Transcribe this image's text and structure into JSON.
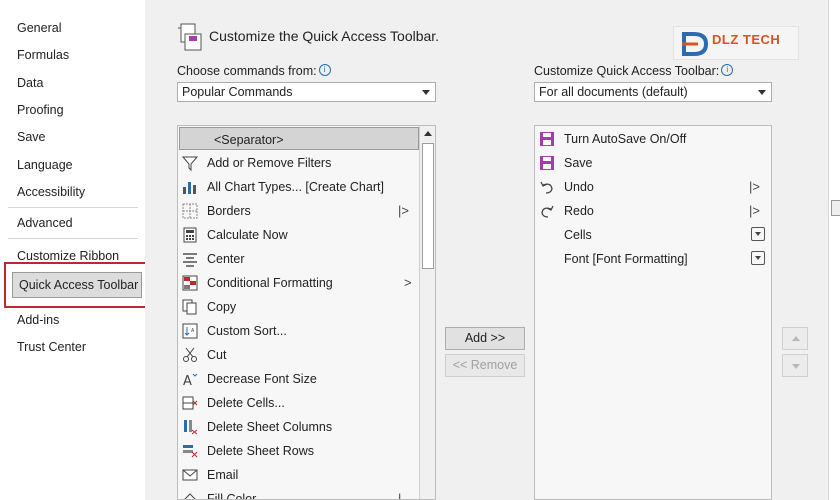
{
  "colors": {
    "accent_red": "#c0272d",
    "purple_icon": "#a63da8",
    "blue": "#2b6cb0"
  },
  "nav": {
    "items": [
      "General",
      "Formulas",
      "Data",
      "Proofing",
      "Save",
      "Language",
      "Accessibility",
      "Advanced",
      "Customize Ribbon",
      "Quick Access Toolbar",
      "Add-ins",
      "Trust Center"
    ],
    "selected": "Quick Access Toolbar"
  },
  "header": {
    "title": "Customize the Quick Access Toolbar.",
    "logo_text": "DLZ TECH"
  },
  "left_panel": {
    "label": "Choose commands from:",
    "dropdown_value": "Popular Commands",
    "commands": [
      {
        "label": "<Separator>",
        "icon": "separator"
      },
      {
        "label": "Add or Remove Filters",
        "icon": "filter-icon"
      },
      {
        "label": "All Chart Types... [Create Chart]",
        "icon": "chart-icon"
      },
      {
        "label": "Borders",
        "icon": "borders-icon",
        "submenu": "|>"
      },
      {
        "label": "Calculate Now",
        "icon": "calculator-icon"
      },
      {
        "label": "Center",
        "icon": "align-center-icon"
      },
      {
        "label": "Conditional Formatting",
        "icon": "conditional-formatting-icon",
        "submenu": ">"
      },
      {
        "label": "Copy",
        "icon": "copy-icon"
      },
      {
        "label": "Custom Sort...",
        "icon": "sort-icon"
      },
      {
        "label": "Cut",
        "icon": "scissors-icon"
      },
      {
        "label": "Decrease Font Size",
        "icon": "decrease-font-icon"
      },
      {
        "label": "Delete Cells...",
        "icon": "delete-cells-icon"
      },
      {
        "label": "Delete Sheet Columns",
        "icon": "delete-columns-icon"
      },
      {
        "label": "Delete Sheet Rows",
        "icon": "delete-rows-icon"
      },
      {
        "label": "Email",
        "icon": "email-icon"
      },
      {
        "label": "Fill Color",
        "icon": "fill-color-icon",
        "submenu": "|"
      }
    ]
  },
  "right_panel": {
    "label": "Customize Quick Access Toolbar:",
    "dropdown_value": "For all documents (default)",
    "commands": [
      {
        "label": "Turn AutoSave On/Off",
        "icon": "autosave-icon"
      },
      {
        "label": "Save",
        "icon": "save-icon"
      },
      {
        "label": "Undo",
        "icon": "undo-icon",
        "submenu": "|>"
      },
      {
        "label": "Redo",
        "icon": "redo-icon",
        "submenu": "|>"
      },
      {
        "label": "Cells",
        "icon": "",
        "submenu": "dropdown"
      },
      {
        "label": "Font [Font Formatting]",
        "icon": "",
        "submenu": "dropdown"
      }
    ]
  },
  "buttons": {
    "add": "Add >>",
    "remove": "<< Remove"
  }
}
